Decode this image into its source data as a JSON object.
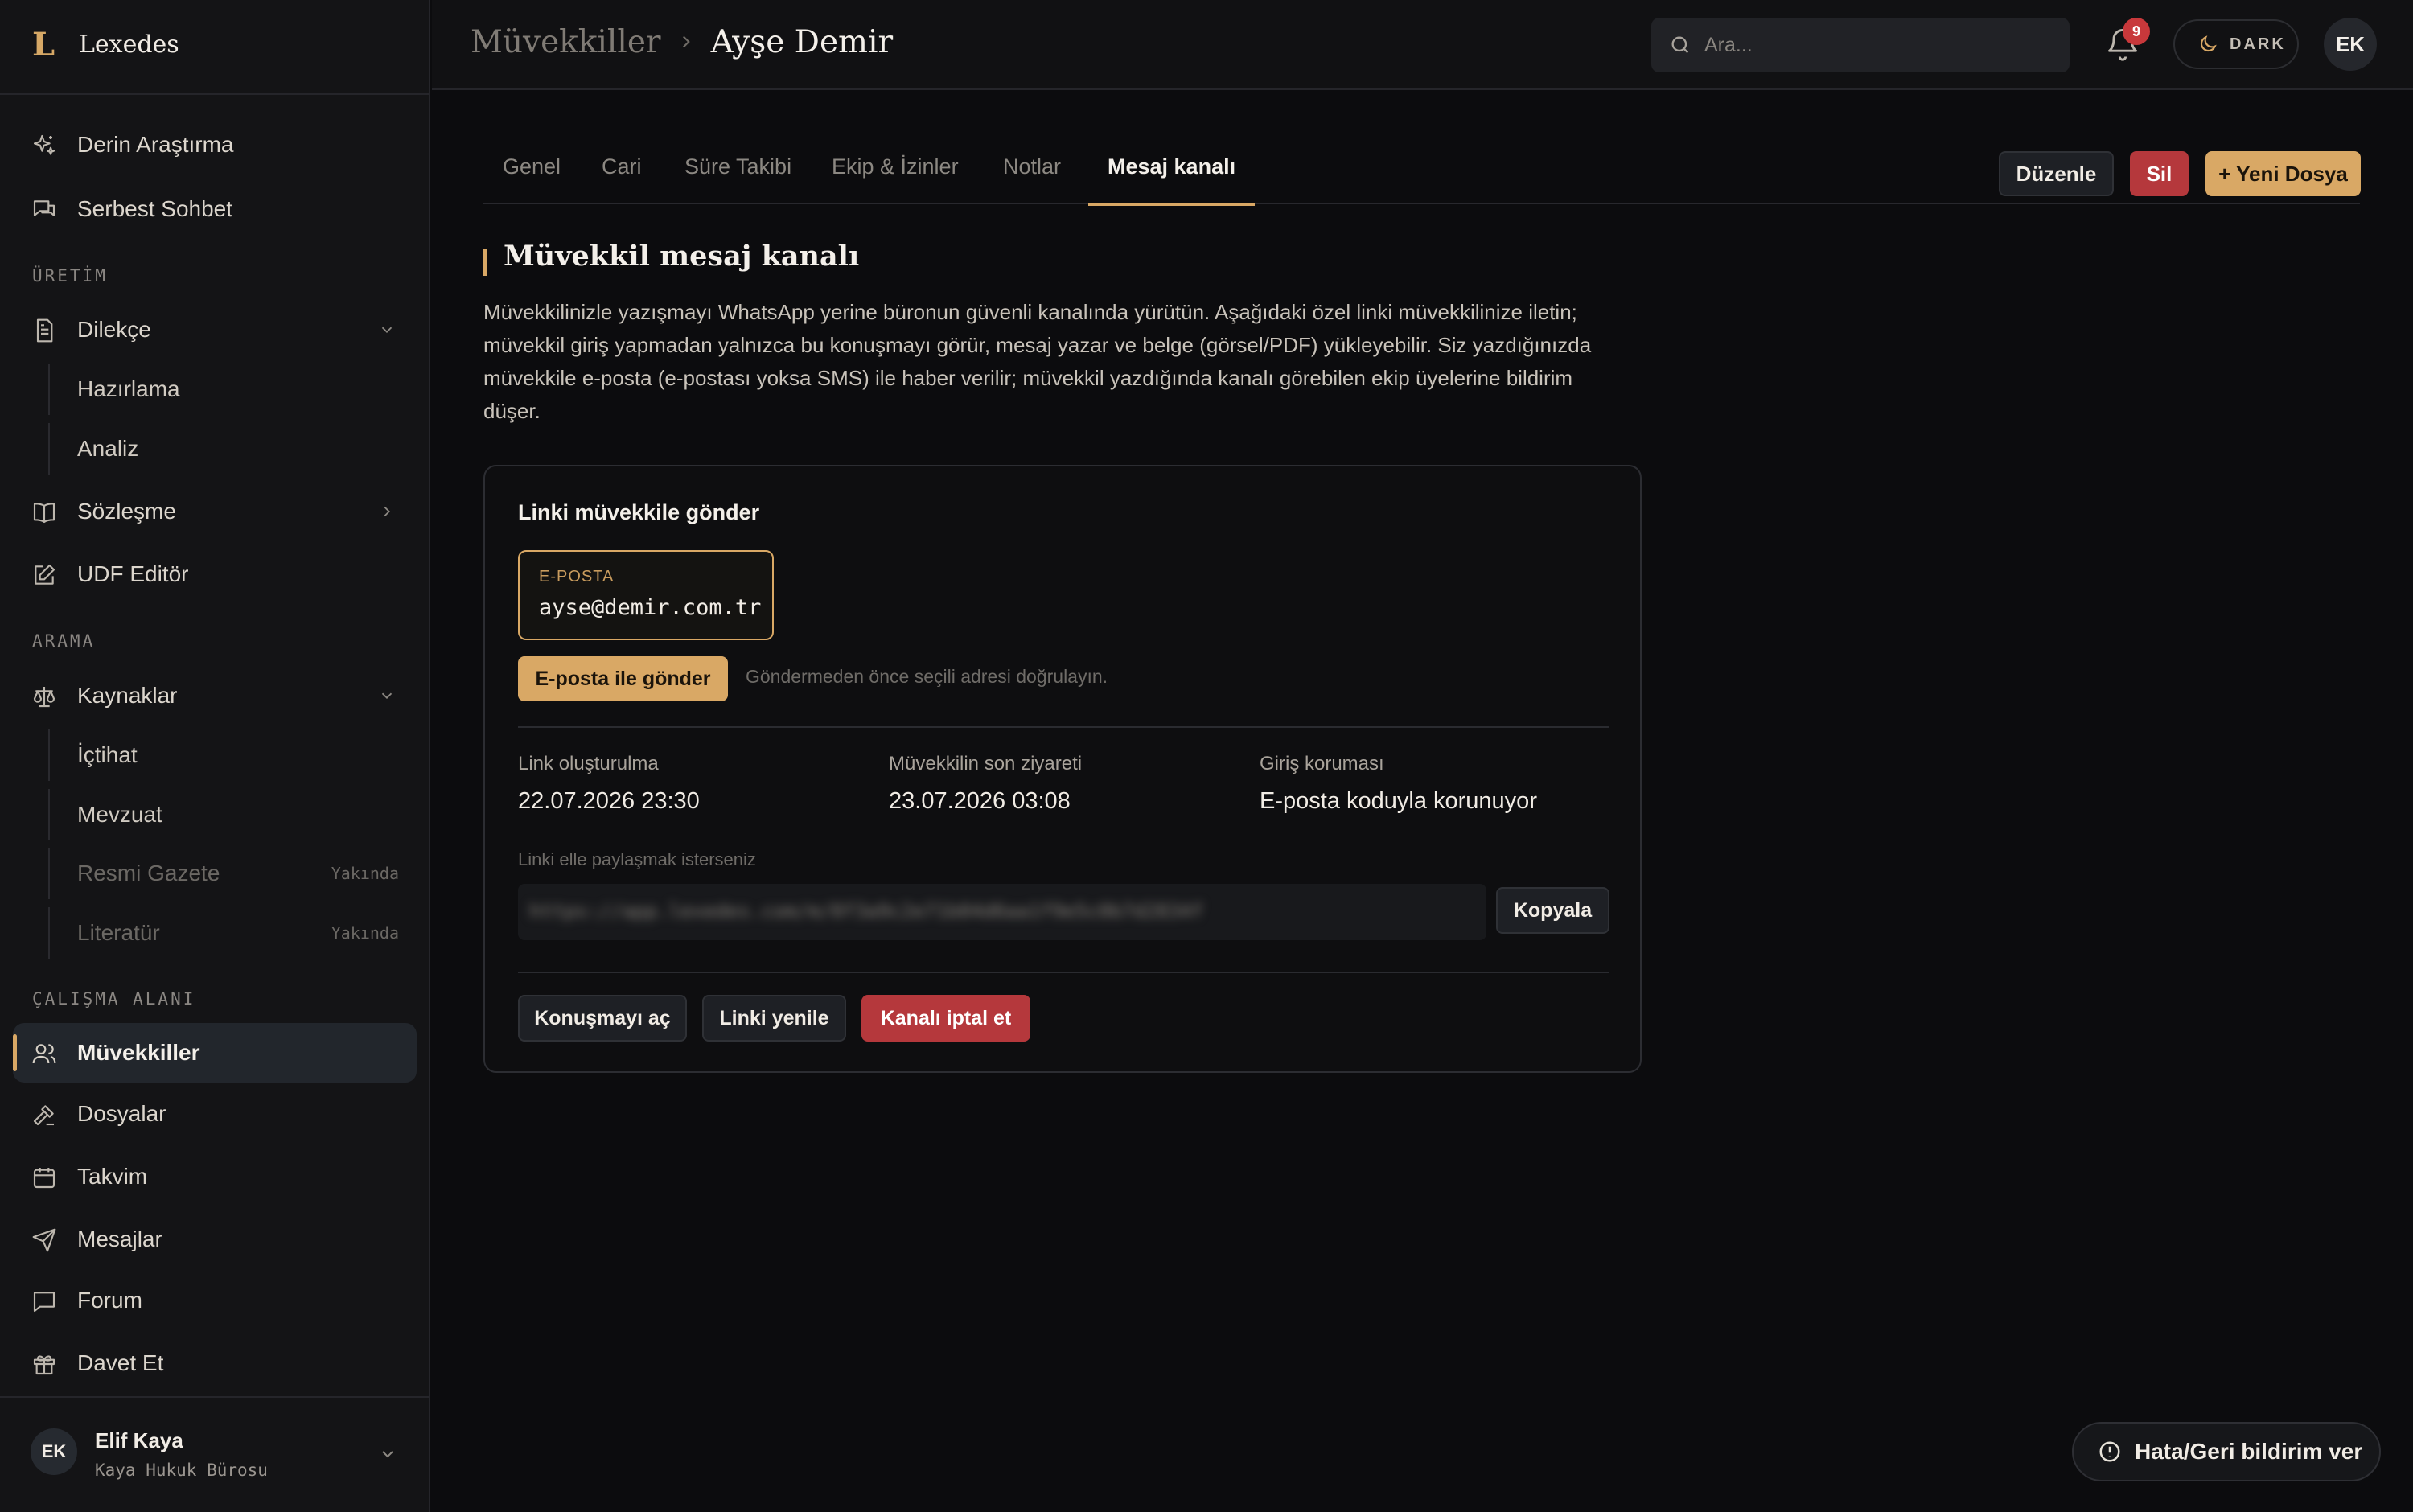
{
  "app": {
    "logo_letter": "L",
    "name": "Lexedes"
  },
  "sidebar": {
    "top_items": [
      {
        "label": "Derin Araştırma",
        "icon": "sparkles-icon"
      },
      {
        "label": "Serbest Sohbet",
        "icon": "chat-icon"
      }
    ],
    "sections": {
      "uretim": "ÜRETİM",
      "arama": "ARAMA",
      "calisma": "ÇALIŞMA ALANI"
    },
    "uretim": {
      "dilekce": "Dilekçe",
      "dilekce_sub": [
        "Hazırlama",
        "Analiz"
      ],
      "sozlesme": "Sözleşme",
      "udf": "UDF Editör"
    },
    "arama": {
      "kaynaklar": "Kaynaklar",
      "kaynaklar_sub": [
        {
          "label": "İçtihat"
        },
        {
          "label": "Mevzuat"
        },
        {
          "label": "Resmi Gazete",
          "badge": "Yakında"
        },
        {
          "label": "Literatür",
          "badge": "Yakında"
        }
      ]
    },
    "calisma": [
      "Müvekkiller",
      "Dosyalar",
      "Takvim",
      "Mesajlar",
      "Forum",
      "Davet Et"
    ],
    "active_item": "Müvekkiller",
    "user": {
      "initials": "EK",
      "name": "Elif Kaya",
      "org": "Kaya Hukuk Bürosu"
    }
  },
  "header": {
    "breadcrumb": [
      "Müvekkiller",
      "Ayşe Demir"
    ],
    "search_placeholder": "Ara...",
    "notification_count": "9",
    "theme_label": "DARK",
    "avatar_initials": "EK"
  },
  "tabs": [
    "Genel",
    "Cari",
    "Süre Takibi",
    "Ekip & İzinler",
    "Notlar",
    "Mesaj kanalı"
  ],
  "active_tab": "Mesaj kanalı",
  "actions": {
    "edit": "Düzenle",
    "delete": "Sil",
    "new_file": "+ Yeni Dosya"
  },
  "section": {
    "title": "Müvekkil mesaj kanalı",
    "description": "Müvekkilinizle yazışmayı WhatsApp yerine büronun güvenli kanalında yürütün. Aşağıdaki özel linki müvekkilinize iletin; müvekkil giriş yapmadan yalnızca bu konuşmayı görür, mesaj yazar ve belge (görsel/PDF) yükleyebilir. Siz yazdığınızda müvekkile e-posta (e-postası yoksa SMS) ile haber verilir; müvekkil yazdığında kanalı görebilen ekip üyelerine bildirim düşer."
  },
  "card": {
    "title": "Linki müvekkile gönder",
    "email_label": "E-POSTA",
    "email_value": "ayse@demir.com.tr",
    "send_button": "E-posta ile gönder",
    "send_hint": "Göndermeden önce seçili adresi doğrulayın.",
    "meta": [
      {
        "label": "Link oluşturulma",
        "value": "22.07.2026 23:30"
      },
      {
        "label": "Müvekkilin son ziyareti",
        "value": "23.07.2026 03:08"
      },
      {
        "label": "Giriş koruması",
        "value": "E-posta koduyla korunuyor"
      }
    ],
    "manual_label": "Linki elle paylaşmak isterseniz",
    "manual_link": "https://app.lexedes.com/m/8f3a9c2e71b04d6aa1f9e5c0b7d2834f",
    "copy_button": "Kopyala",
    "open_button": "Konuşmayı aç",
    "renew_button": "Linki yenile",
    "cancel_button": "Kanalı iptal et"
  },
  "feedback_button": "Hata/Geri bildirim ver",
  "colors": {
    "accent": "#d9a865",
    "danger": "#b5383c",
    "background": "#0c0c0e",
    "sidebar": "#141416"
  }
}
